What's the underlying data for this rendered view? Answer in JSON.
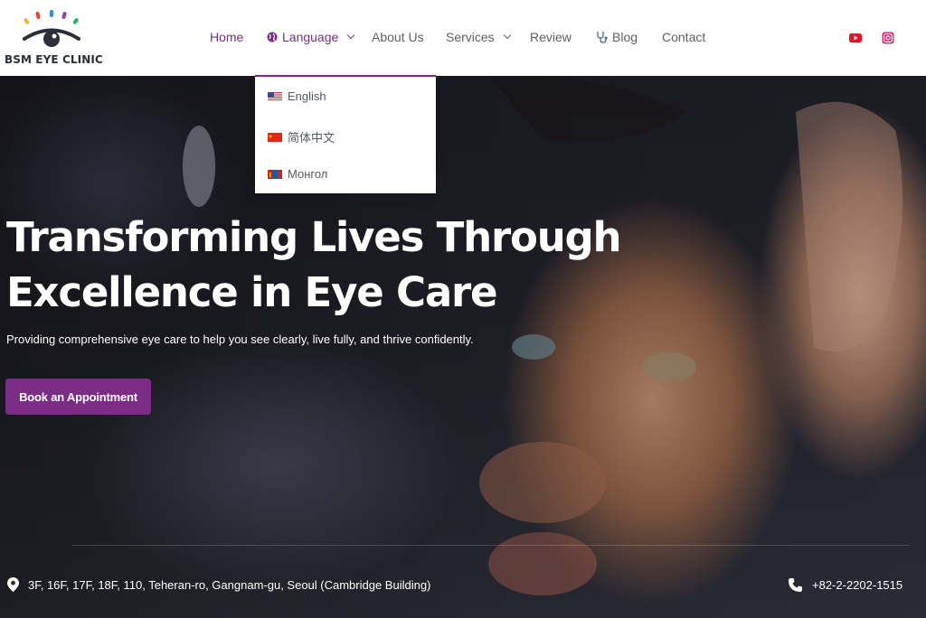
{
  "brand": {
    "name": "BSM EYE CLINIC"
  },
  "nav": {
    "home": "Home",
    "language": "Language",
    "about": "About Us",
    "services": "Services",
    "review": "Review",
    "blog": "Blog",
    "contact": "Contact"
  },
  "language_menu": {
    "items": [
      {
        "label": "English",
        "icon": "us-flag-icon"
      },
      {
        "label": "简体中文",
        "icon": "china-flag-icon"
      },
      {
        "label": "Монгол",
        "icon": "mongolia-flag-icon"
      }
    ]
  },
  "hero": {
    "headline_line1": "Transforming Lives Through",
    "headline_line2": "Excellence in Eye Care",
    "subtext": "Providing comprehensive eye care to help you see clearly, live fully, and thrive confidently.",
    "cta": "Book an Appointment"
  },
  "footer_bar": {
    "address": "3F, 16F, 17F, 18F, 110, Teheran-ro, Gangnam-gu, Seoul (Cambridge Building)",
    "phone": "+82-2-2202-1515"
  },
  "colors": {
    "accent": "#7b2d86",
    "youtube": "#e0162b",
    "instagram": "#d6246e"
  }
}
